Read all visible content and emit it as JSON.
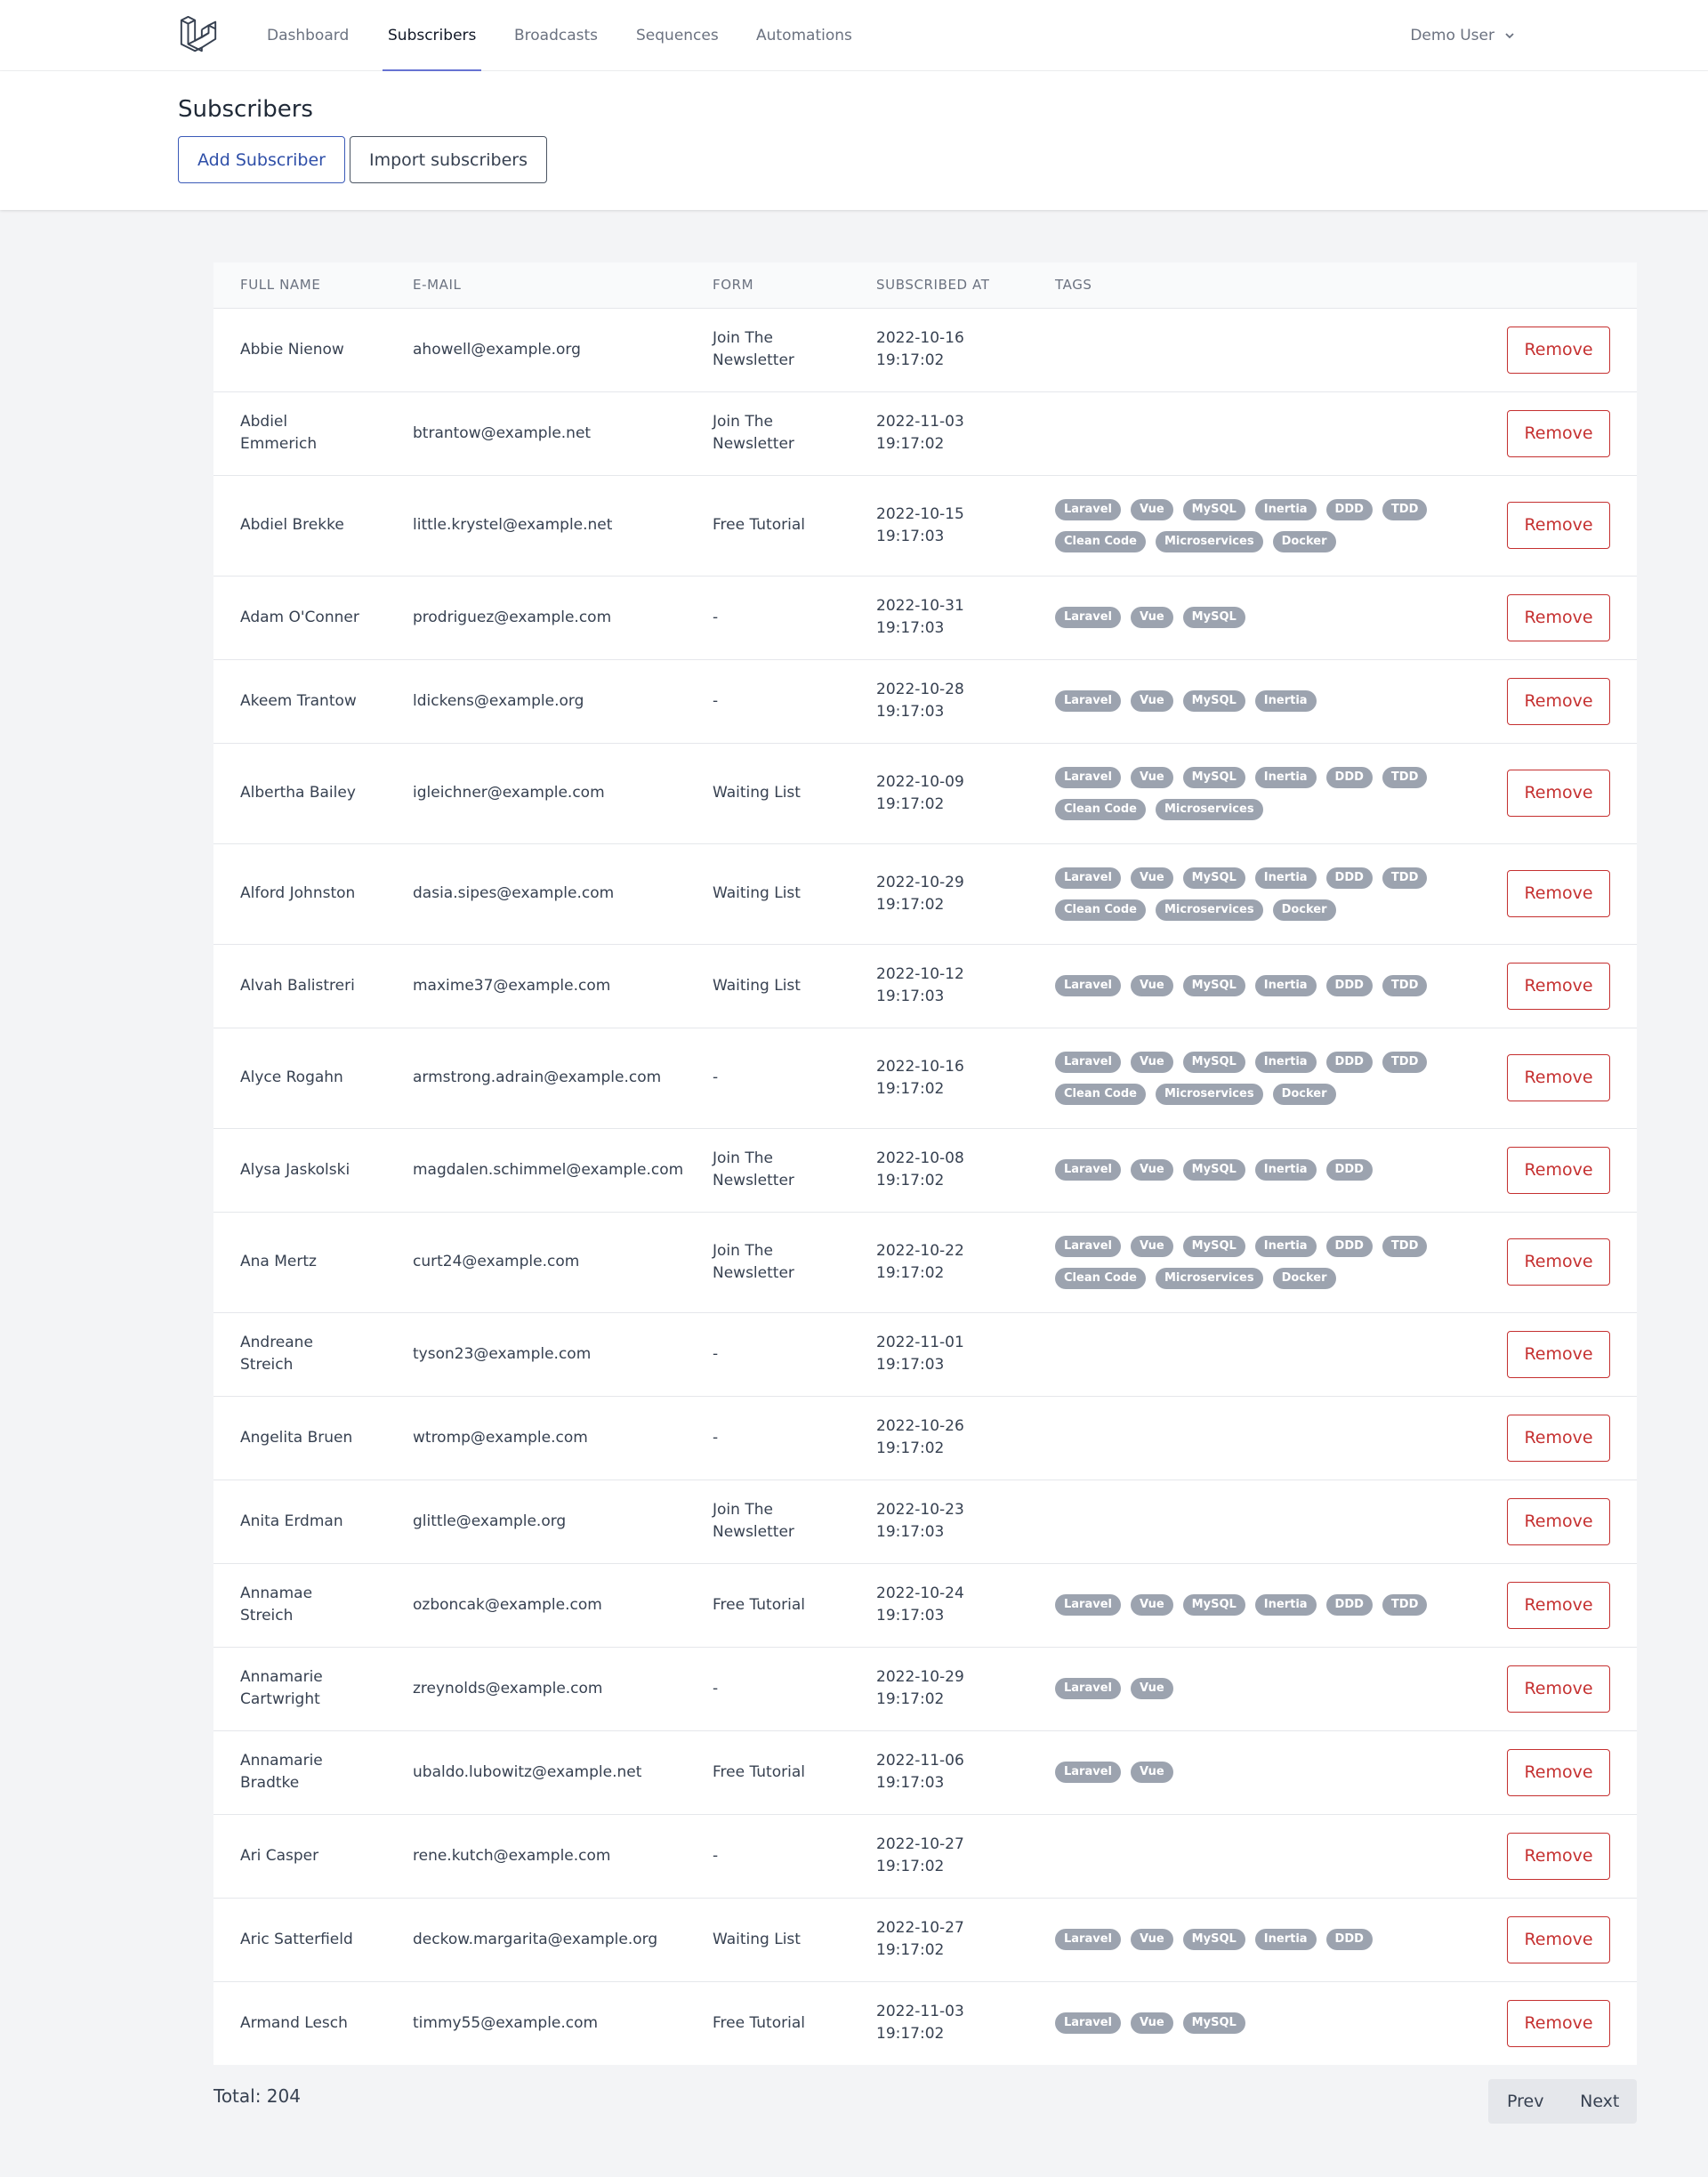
{
  "nav": {
    "links": [
      "Dashboard",
      "Subscribers",
      "Broadcasts",
      "Sequences",
      "Automations"
    ],
    "active": "Subscribers",
    "user": "Demo User"
  },
  "header": {
    "title": "Subscribers",
    "add_label": "Add Subscriber",
    "import_label": "Import subscribers"
  },
  "table": {
    "columns": [
      "Full Name",
      "E-mail",
      "Form",
      "Subscribed At",
      "Tags"
    ],
    "remove_label": "Remove",
    "rows": [
      {
        "name": "Abbie Nienow",
        "email": "ahowell@example.org",
        "form": "Join The Newsletter",
        "date": "2022-10-16",
        "time": "19:17:02",
        "tags": []
      },
      {
        "name": "Abdiel Emmerich",
        "email": "btrantow@example.net",
        "form": "Join The Newsletter",
        "date": "2022-11-03",
        "time": "19:17:02",
        "tags": []
      },
      {
        "name": "Abdiel Brekke",
        "email": "little.krystel@example.net",
        "form": "Free Tutorial",
        "date": "2022-10-15",
        "time": "19:17:03",
        "tags": [
          "Laravel",
          "Vue",
          "MySQL",
          "Inertia",
          "DDD",
          "TDD",
          "Clean Code",
          "Microservices",
          "Docker"
        ]
      },
      {
        "name": "Adam O'Conner",
        "email": "prodriguez@example.com",
        "form": "-",
        "date": "2022-10-31",
        "time": "19:17:03",
        "tags": [
          "Laravel",
          "Vue",
          "MySQL"
        ]
      },
      {
        "name": "Akeem Trantow",
        "email": "ldickens@example.org",
        "form": "-",
        "date": "2022-10-28",
        "time": "19:17:03",
        "tags": [
          "Laravel",
          "Vue",
          "MySQL",
          "Inertia"
        ]
      },
      {
        "name": "Albertha Bailey",
        "email": "igleichner@example.com",
        "form": "Waiting List",
        "date": "2022-10-09",
        "time": "19:17:02",
        "tags": [
          "Laravel",
          "Vue",
          "MySQL",
          "Inertia",
          "DDD",
          "TDD",
          "Clean Code",
          "Microservices"
        ]
      },
      {
        "name": "Alford Johnston",
        "email": "dasia.sipes@example.com",
        "form": "Waiting List",
        "date": "2022-10-29",
        "time": "19:17:02",
        "tags": [
          "Laravel",
          "Vue",
          "MySQL",
          "Inertia",
          "DDD",
          "TDD",
          "Clean Code",
          "Microservices",
          "Docker"
        ]
      },
      {
        "name": "Alvah Balistreri",
        "email": "maxime37@example.com",
        "form": "Waiting List",
        "date": "2022-10-12",
        "time": "19:17:03",
        "tags": [
          "Laravel",
          "Vue",
          "MySQL",
          "Inertia",
          "DDD",
          "TDD"
        ]
      },
      {
        "name": "Alyce Rogahn",
        "email": "armstrong.adrain@example.com",
        "form": "-",
        "date": "2022-10-16",
        "time": "19:17:02",
        "tags": [
          "Laravel",
          "Vue",
          "MySQL",
          "Inertia",
          "DDD",
          "TDD",
          "Clean Code",
          "Microservices",
          "Docker"
        ]
      },
      {
        "name": "Alysa Jaskolski",
        "email": "magdalen.schimmel@example.com",
        "form": "Join The Newsletter",
        "date": "2022-10-08",
        "time": "19:17:02",
        "tags": [
          "Laravel",
          "Vue",
          "MySQL",
          "Inertia",
          "DDD"
        ]
      },
      {
        "name": "Ana Mertz",
        "email": "curt24@example.com",
        "form": "Join The Newsletter",
        "date": "2022-10-22",
        "time": "19:17:02",
        "tags": [
          "Laravel",
          "Vue",
          "MySQL",
          "Inertia",
          "DDD",
          "TDD",
          "Clean Code",
          "Microservices",
          "Docker"
        ]
      },
      {
        "name": "Andreane Streich",
        "email": "tyson23@example.com",
        "form": "-",
        "date": "2022-11-01",
        "time": "19:17:03",
        "tags": []
      },
      {
        "name": "Angelita Bruen",
        "email": "wtromp@example.com",
        "form": "-",
        "date": "2022-10-26",
        "time": "19:17:02",
        "tags": []
      },
      {
        "name": "Anita Erdman",
        "email": "glittle@example.org",
        "form": "Join The Newsletter",
        "date": "2022-10-23",
        "time": "19:17:03",
        "tags": []
      },
      {
        "name": "Annamae Streich",
        "email": "ozboncak@example.com",
        "form": "Free Tutorial",
        "date": "2022-10-24",
        "time": "19:17:03",
        "tags": [
          "Laravel",
          "Vue",
          "MySQL",
          "Inertia",
          "DDD",
          "TDD"
        ]
      },
      {
        "name": "Annamarie Cartwright",
        "email": "zreynolds@example.com",
        "form": "-",
        "date": "2022-10-29",
        "time": "19:17:02",
        "tags": [
          "Laravel",
          "Vue"
        ]
      },
      {
        "name": "Annamarie Bradtke",
        "email": "ubaldo.lubowitz@example.net",
        "form": "Free Tutorial",
        "date": "2022-11-06",
        "time": "19:17:03",
        "tags": [
          "Laravel",
          "Vue"
        ]
      },
      {
        "name": "Ari Casper",
        "email": "rene.kutch@example.com",
        "form": "-",
        "date": "2022-10-27",
        "time": "19:17:02",
        "tags": []
      },
      {
        "name": "Aric Satterfield",
        "email": "deckow.margarita@example.org",
        "form": "Waiting List",
        "date": "2022-10-27",
        "time": "19:17:02",
        "tags": [
          "Laravel",
          "Vue",
          "MySQL",
          "Inertia",
          "DDD"
        ]
      },
      {
        "name": "Armand Lesch",
        "email": "timmy55@example.com",
        "form": "Free Tutorial",
        "date": "2022-11-03",
        "time": "19:17:02",
        "tags": [
          "Laravel",
          "Vue",
          "MySQL"
        ]
      }
    ]
  },
  "footer": {
    "total_label": "Total: 204",
    "prev_label": "Prev",
    "next_label": "Next"
  }
}
